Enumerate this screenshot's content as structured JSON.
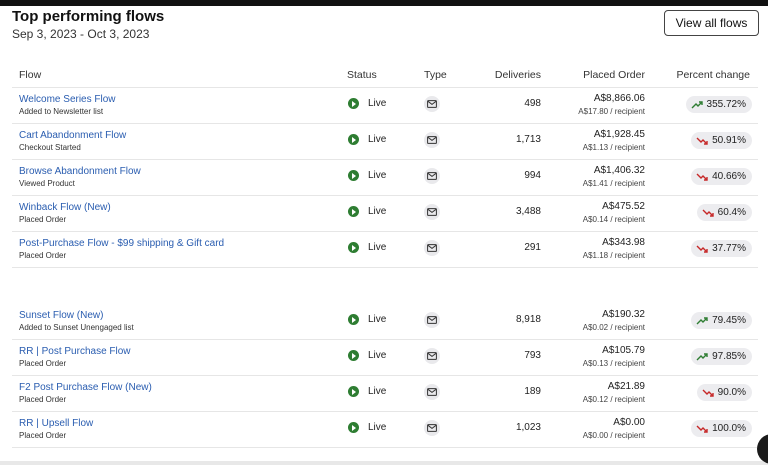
{
  "header": {
    "title": "Top performing flows",
    "date_range": "Sep 3, 2023 - Oct 3, 2023",
    "view_all_label": "View all flows"
  },
  "columns": {
    "flow": "Flow",
    "status": "Status",
    "type": "Type",
    "deliveries": "Deliveries",
    "placed_order": "Placed Order",
    "percent_change": "Percent change"
  },
  "colors": {
    "link": "#2a5db0",
    "live": "#2e7d32",
    "trend_up": "#2e7d32",
    "trend_down": "#c62828"
  },
  "rows": [
    {
      "name": "Welcome Series Flow",
      "trigger": "Added to Newsletter list",
      "status": "Live",
      "type_icon": "email-icon",
      "deliveries": "498",
      "placed_order": "A$8,866.06",
      "per_recipient": "A$17.80 / recipient",
      "percent_change": "355.72%",
      "trend": "up"
    },
    {
      "name": "Cart Abandonment Flow",
      "trigger": "Checkout Started",
      "status": "Live",
      "type_icon": "email-icon",
      "deliveries": "1,713",
      "placed_order": "A$1,928.45",
      "per_recipient": "A$1.13 / recipient",
      "percent_change": "50.91%",
      "trend": "down"
    },
    {
      "name": "Browse Abandonment Flow",
      "trigger": "Viewed Product",
      "status": "Live",
      "type_icon": "email-icon",
      "deliveries": "994",
      "placed_order": "A$1,406.32",
      "per_recipient": "A$1.41 / recipient",
      "percent_change": "40.66%",
      "trend": "down"
    },
    {
      "name": "Winback Flow (New)",
      "trigger": "Placed Order",
      "status": "Live",
      "type_icon": "email-icon",
      "deliveries": "3,488",
      "placed_order": "A$475.52",
      "per_recipient": "A$0.14 / recipient",
      "percent_change": "60.4%",
      "trend": "down"
    },
    {
      "name": "Post-Purchase Flow - $99 shipping & Gift card",
      "trigger": "Placed Order",
      "status": "Live",
      "type_icon": "email-icon",
      "deliveries": "291",
      "placed_order": "A$343.98",
      "per_recipient": "A$1.18 / recipient",
      "percent_change": "37.77%",
      "trend": "down"
    },
    {
      "name": "Sunset Flow (New)",
      "trigger": "Added to Sunset Unengaged list",
      "status": "Live",
      "type_icon": "email-icon",
      "deliveries": "8,918",
      "placed_order": "A$190.32",
      "per_recipient": "A$0.02 / recipient",
      "percent_change": "79.45%",
      "trend": "up"
    },
    {
      "name": "RR | Post Purchase Flow",
      "trigger": "Placed Order",
      "status": "Live",
      "type_icon": "email-icon",
      "deliveries": "793",
      "placed_order": "A$105.79",
      "per_recipient": "A$0.13 / recipient",
      "percent_change": "97.85%",
      "trend": "up"
    },
    {
      "name": "F2 Post Purchase Flow (New)",
      "trigger": "Placed Order",
      "status": "Live",
      "type_icon": "email-icon",
      "deliveries": "189",
      "placed_order": "A$21.89",
      "per_recipient": "A$0.12 / recipient",
      "percent_change": "90.0%",
      "trend": "down"
    },
    {
      "name": "RR | Upsell Flow",
      "trigger": "Placed Order",
      "status": "Live",
      "type_icon": "email-icon",
      "deliveries": "1,023",
      "placed_order": "A$0.00",
      "per_recipient": "A$0.00 / recipient",
      "percent_change": "100.0%",
      "trend": "down"
    }
  ]
}
